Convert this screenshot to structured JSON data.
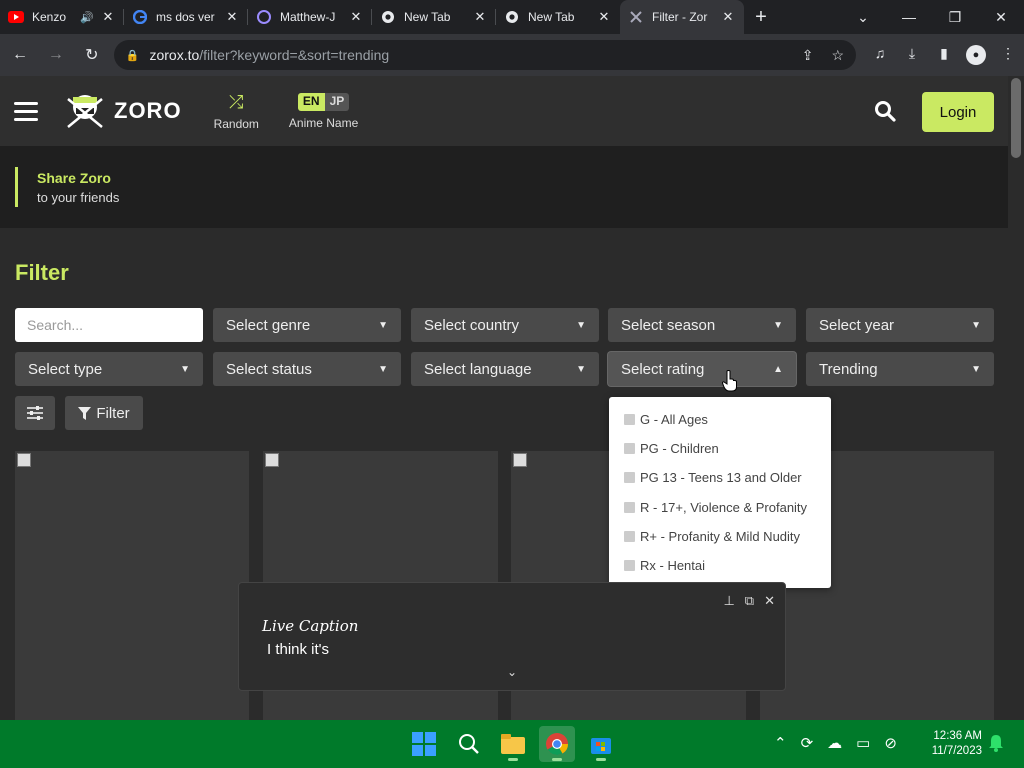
{
  "browser": {
    "tabs": [
      {
        "title": "Kenzo",
        "favicon": "youtube-icon"
      },
      {
        "title": "ms dos ver",
        "favicon": "google-icon"
      },
      {
        "title": "Matthew-J",
        "favicon": "app-icon"
      },
      {
        "title": "New Tab",
        "favicon": "chrome-icon"
      },
      {
        "title": "New Tab",
        "favicon": "chrome-icon"
      },
      {
        "title": "Filter - Zor",
        "favicon": "zoro-icon",
        "active": true
      }
    ],
    "url_host": "zorox.to",
    "url_path": "/filter?keyword=&sort=trending"
  },
  "header": {
    "logo_text": "ZORO",
    "random_label": "Random",
    "lang_en": "EN",
    "lang_jp": "JP",
    "anime_name_label": "Anime Name",
    "login_label": "Login"
  },
  "share": {
    "title": "Share Zoro",
    "subtitle": "to your friends"
  },
  "filter": {
    "title": "Filter",
    "search_placeholder": "Search...",
    "selects_row1": [
      "Select genre",
      "Select country",
      "Select season",
      "Select year"
    ],
    "selects_row2": [
      "Select type",
      "Select status",
      "Select language",
      "Select rating",
      "Trending"
    ],
    "filter_button": "Filter",
    "rating_options": [
      "G - All Ages",
      "PG - Children",
      "PG 13 - Teens 13 and Older",
      "R - 17+, Violence & Profanity",
      "R+ - Profanity & Mild Nudity",
      "Rx - Hentai"
    ]
  },
  "caption": {
    "title": "Live Caption",
    "text": "I think it's"
  },
  "taskbar": {
    "time": "12:36 AM",
    "date": "11/7/2023"
  },
  "colors": {
    "accent": "#cae962",
    "taskbar": "#007a2a"
  }
}
